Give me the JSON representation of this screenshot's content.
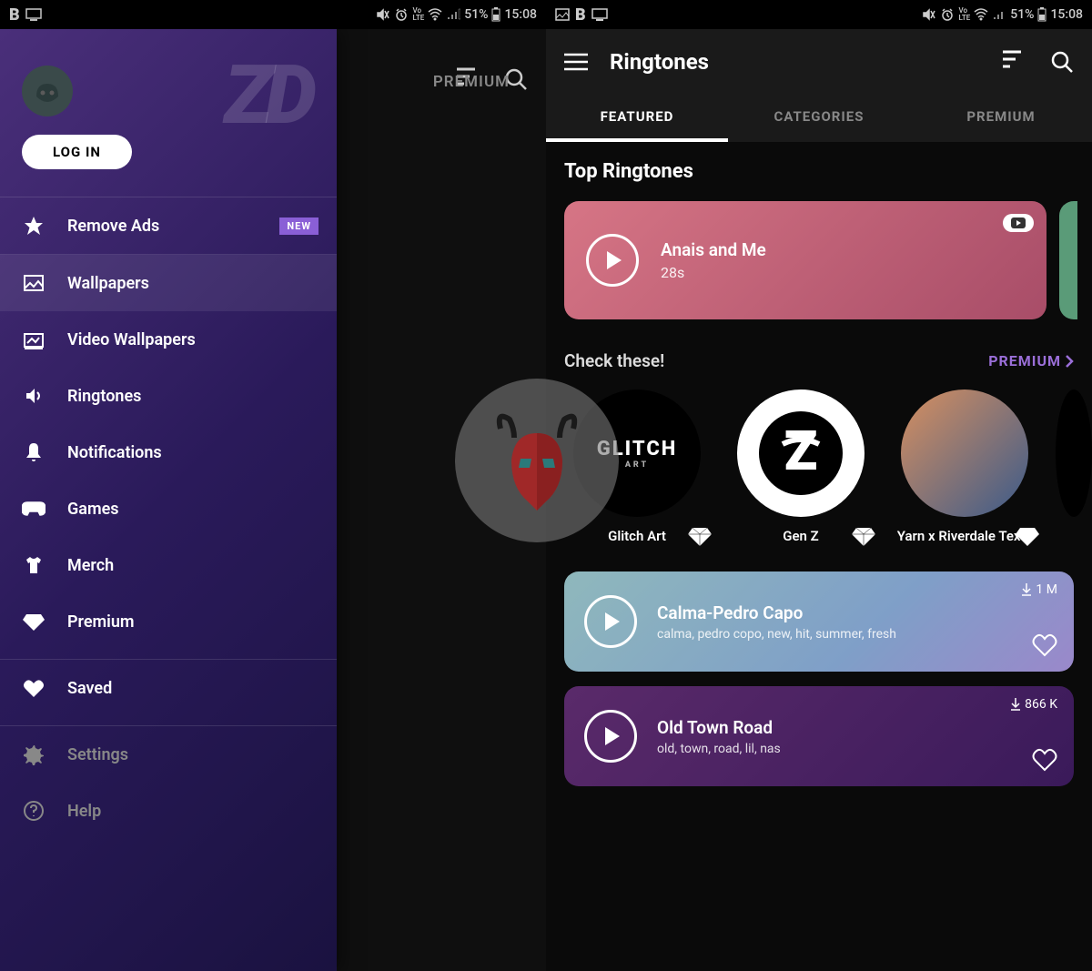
{
  "status": {
    "battery_pct": "51%",
    "time": "15:08",
    "vo_lte": "Vo\nLTE"
  },
  "screen1": {
    "background_tab": "PREMIUM",
    "login": "LOG IN",
    "items": [
      {
        "label": "Remove Ads",
        "badge": "NEW"
      },
      {
        "label": "Wallpapers"
      },
      {
        "label": "Video Wallpapers"
      },
      {
        "label": "Ringtones"
      },
      {
        "label": "Notifications"
      },
      {
        "label": "Games"
      },
      {
        "label": "Merch"
      },
      {
        "label": "Premium"
      }
    ],
    "saved": "Saved",
    "settings": "Settings",
    "help": "Help"
  },
  "screen2": {
    "title": "Ringtones",
    "tabs": [
      "FEATURED",
      "CATEGORIES",
      "PREMIUM"
    ],
    "section_top": "Top Ringtones",
    "hero": {
      "title": "Anais and Me",
      "duration": "28s"
    },
    "check_these": "Check these!",
    "premium_link": "PREMIUM",
    "circles": [
      {
        "label": "Glitch Art",
        "text": "GLITCH",
        "sub": "ART"
      },
      {
        "label": "Gen Z"
      },
      {
        "label": "Yarn x Riverdale Texts"
      }
    ],
    "list": [
      {
        "title": "Calma-Pedro Capo",
        "tags": "calma, pedro copo, new, hit, summer, fresh",
        "downloads": "1 M"
      },
      {
        "title": "Old Town Road",
        "tags": "old, town, road, lil, nas",
        "downloads": "866 K"
      }
    ]
  }
}
